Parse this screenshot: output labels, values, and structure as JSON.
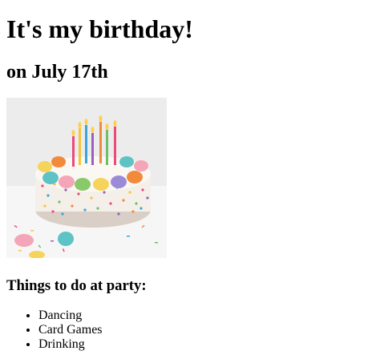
{
  "heading": "It's my birthday!",
  "subheading": "on July 17th",
  "image": {
    "alt": "Birthday cake with candles and macarons",
    "icon": "birthday-cake-photo"
  },
  "party_heading": "Things to do at party:",
  "activities": [
    "Dancing",
    "Card Games",
    "Drinking"
  ],
  "colors": {
    "cake_frosting": "#f7f2ee",
    "sprinkles": [
      "#e94b7b",
      "#3aa6d8",
      "#f5c53a",
      "#6cc06a",
      "#9b5fc0",
      "#f28a3c"
    ],
    "macaron_pink": "#f4a6b8",
    "macaron_teal": "#5ec3c4",
    "macaron_yellow": "#f6d35b",
    "macaron_green": "#88c96a"
  }
}
